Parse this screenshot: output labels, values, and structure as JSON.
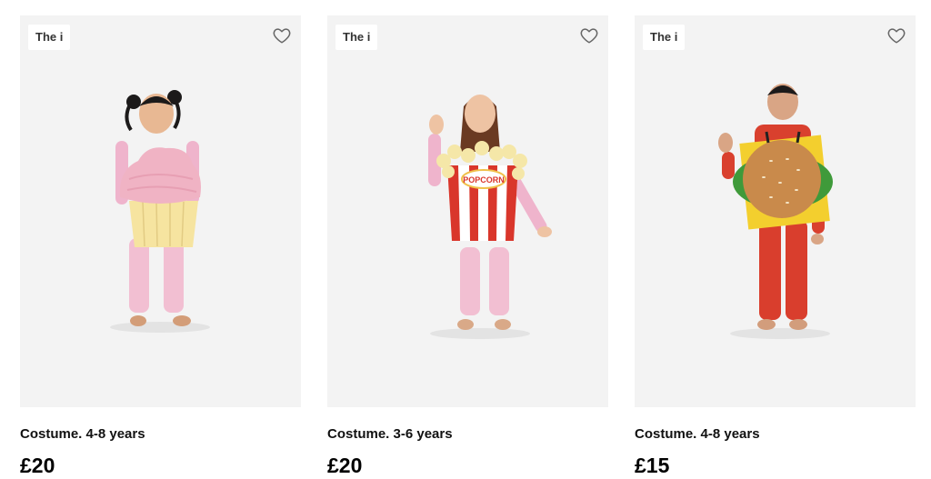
{
  "products": [
    {
      "badge": "The i",
      "title": "Costume. 4-8 years",
      "price": "£20",
      "image": "child-in-cupcake-costume"
    },
    {
      "badge": "The i",
      "title": "Costume. 3-6 years",
      "price": "£20",
      "image": "child-in-popcorn-costume",
      "costume_text": "POPCORN"
    },
    {
      "badge": "The i",
      "title": "Costume. 4-8 years",
      "price": "£15",
      "image": "child-in-burger-costume"
    }
  ],
  "colors": {
    "image_bg": "#f3f3f3",
    "cupcake_frosting": "#f0b3c4",
    "cupcake_base": "#f6e4a0",
    "popcorn_red": "#d9362b",
    "burger_bun": "#c98a4b",
    "burger_lettuce": "#3f9a3a"
  },
  "icons": {
    "favorite": "heart-outline-icon"
  }
}
